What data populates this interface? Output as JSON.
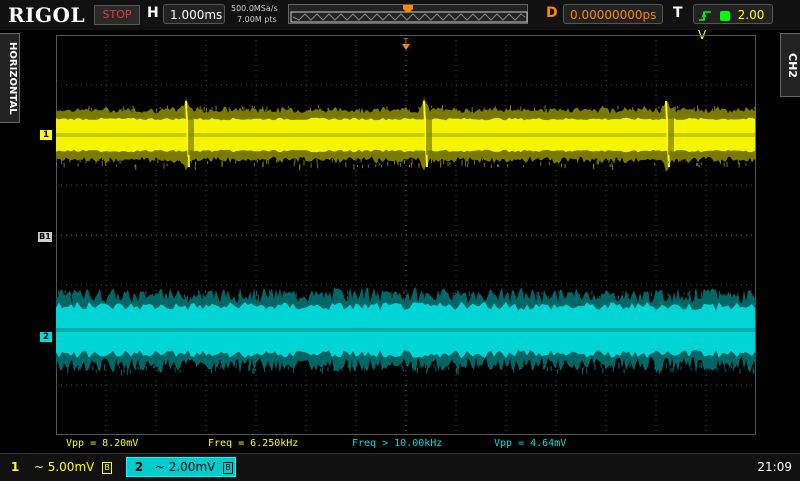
{
  "header": {
    "brand": "RIGOL",
    "run_status": "STOP",
    "horizontal_label": "H",
    "timebase": "1.000ms",
    "sample_rate": "500.0MSa/s",
    "memory_depth": "7.00M pts",
    "delay_label": "D",
    "delay": "0.00000000ps",
    "trigger_label": "T",
    "trigger_level": "2.00 V"
  },
  "side_tabs": {
    "left": "HORIZONTAL",
    "right": "CH2"
  },
  "markers": {
    "ch1": "1",
    "ch2": "2",
    "ref": "B1"
  },
  "measurements": [
    {
      "label": "Vpp = 8.20mV"
    },
    {
      "label": "Freq = 6.250kHz"
    },
    {
      "label": "Freq > 10.00kHz"
    },
    {
      "label": "Vpp = 4.64mV"
    }
  ],
  "channels": [
    {
      "num": "1",
      "coupling": "~",
      "scale": "5.00mV",
      "color": "#ffff00"
    },
    {
      "num": "2",
      "coupling": "~",
      "scale": "2.00mV",
      "color": "#00dddd"
    }
  ],
  "clock": "21:09",
  "colors": {
    "ch1": "#ffff00",
    "ch2": "#00dddd",
    "trigger": "#ff8800",
    "stop": "#ee3333"
  }
}
